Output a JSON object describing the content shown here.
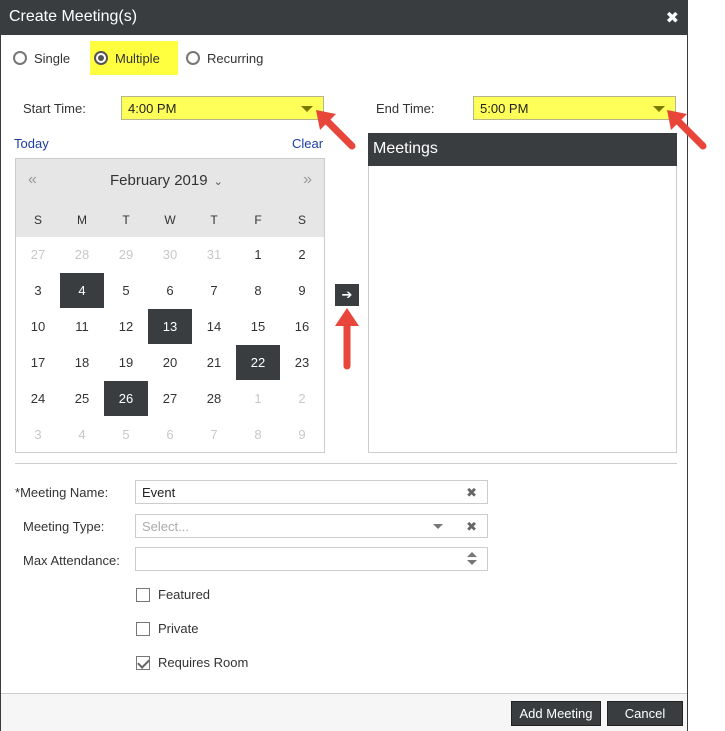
{
  "dialog": {
    "title": "Create Meeting(s)",
    "close_glyph": "✖"
  },
  "mode": {
    "options": [
      {
        "label": "Single",
        "checked": false
      },
      {
        "label": "Multiple",
        "checked": true
      },
      {
        "label": "Recurring",
        "checked": false
      }
    ]
  },
  "times": {
    "start_label": "Start Time:",
    "start_value": "4:00 PM",
    "end_label": "End Time:",
    "end_value": "5:00 PM"
  },
  "calendar": {
    "today_label": "Today",
    "clear_label": "Clear",
    "prev_glyph": "«",
    "next_glyph": "»",
    "month_label": "February 2019",
    "month_chevron": "⌄",
    "weekdays": [
      "S",
      "M",
      "T",
      "W",
      "T",
      "F",
      "S"
    ],
    "weeks": [
      [
        {
          "d": "27",
          "muted": true
        },
        {
          "d": "28",
          "muted": true
        },
        {
          "d": "29",
          "muted": true
        },
        {
          "d": "30",
          "muted": true
        },
        {
          "d": "31",
          "muted": true
        },
        {
          "d": "1"
        },
        {
          "d": "2"
        }
      ],
      [
        {
          "d": "3"
        },
        {
          "d": "4",
          "selected": true
        },
        {
          "d": "5"
        },
        {
          "d": "6"
        },
        {
          "d": "7"
        },
        {
          "d": "8"
        },
        {
          "d": "9"
        }
      ],
      [
        {
          "d": "10"
        },
        {
          "d": "11"
        },
        {
          "d": "12"
        },
        {
          "d": "13",
          "selected": true
        },
        {
          "d": "14"
        },
        {
          "d": "15"
        },
        {
          "d": "16"
        }
      ],
      [
        {
          "d": "17"
        },
        {
          "d": "18"
        },
        {
          "d": "19"
        },
        {
          "d": "20"
        },
        {
          "d": "21"
        },
        {
          "d": "22",
          "selected": true
        },
        {
          "d": "23"
        }
      ],
      [
        {
          "d": "24"
        },
        {
          "d": "25"
        },
        {
          "d": "26",
          "selected": true
        },
        {
          "d": "27"
        },
        {
          "d": "28"
        },
        {
          "d": "1",
          "muted": true
        },
        {
          "d": "2",
          "muted": true
        }
      ],
      [
        {
          "d": "3",
          "muted": true
        },
        {
          "d": "4",
          "muted": true
        },
        {
          "d": "5",
          "muted": true
        },
        {
          "d": "6",
          "muted": true
        },
        {
          "d": "7",
          "muted": true
        },
        {
          "d": "8",
          "muted": true
        },
        {
          "d": "9",
          "muted": true
        }
      ]
    ]
  },
  "add_arrow": {
    "glyph": "➔"
  },
  "meetings": {
    "heading": "Meetings"
  },
  "form": {
    "name_required_mark": "*",
    "name_label": "Meeting Name:",
    "name_value": "Event",
    "type_label": "Meeting Type:",
    "type_placeholder": "Select...",
    "attendance_label": "Max Attendance:",
    "attendance_value": "",
    "clear_glyph": "✖",
    "checkboxes": [
      {
        "label": "Featured",
        "checked": false
      },
      {
        "label": "Private",
        "checked": false
      },
      {
        "label": "Requires Room",
        "checked": true
      }
    ]
  },
  "footer": {
    "add_label": "Add Meeting",
    "cancel_label": "Cancel"
  },
  "colors": {
    "header_bg": "#3a3d40",
    "highlight": "#ffff40",
    "selected_day": "#3a3d40",
    "annotation_arrow": "#e8463a"
  }
}
